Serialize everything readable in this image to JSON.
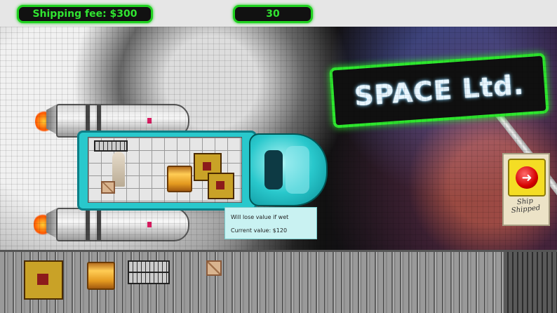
{
  "hud": {
    "shipping_fee": "Shipping fee: $300",
    "timer": "30"
  },
  "sign": {
    "text": "SPACE Ltd."
  },
  "ship_button": {
    "label_line1": "Ship",
    "label_line2": "Shipped"
  },
  "tooltip": {
    "line1": "Will lose value if wet",
    "line2": "Current value: $120"
  },
  "colors": {
    "hud_border": "#1fd11f",
    "hud_text": "#31e431",
    "ship_hull": "#29c8cc"
  },
  "icons": {
    "ship_button": "red-arrow-button-icon"
  }
}
